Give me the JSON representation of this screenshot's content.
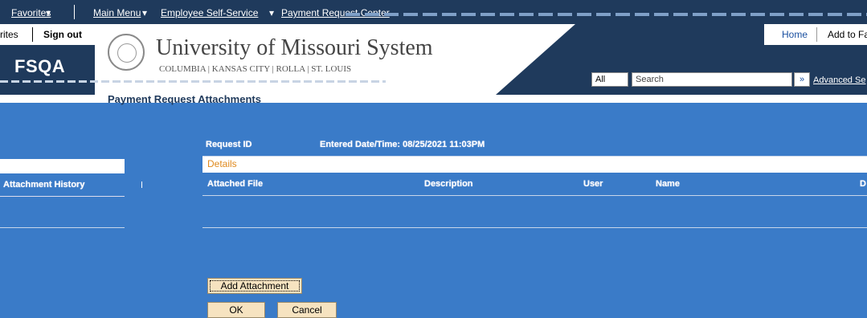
{
  "topnav": {
    "favorites": "Favorites",
    "main_menu": "Main Menu",
    "employee_self_service": "Employee Self-Service",
    "payment_request_center": "Payment Request Center"
  },
  "header": {
    "favorites_partial": "rites",
    "sign_out": "Sign out",
    "home": "Home",
    "add_to_favorites": "Add to Fav",
    "env": "FSQA",
    "university_name": "University of Missouri System",
    "campuses": "COLUMBIA | KANSAS CITY | ROLLA | ST. LOUIS",
    "search_scope": "All",
    "search_placeholder": "Search",
    "advanced_search": "Advanced Se"
  },
  "page": {
    "title": "Payment Request Attachments"
  },
  "request": {
    "request_id_label": "Request ID",
    "entered_label": "Entered Date/Time: 08/25/2021 11:03PM"
  },
  "left_panel": {
    "row_label": "Attachment History"
  },
  "details": {
    "title": "Details",
    "columns": [
      "Attached File",
      "Description",
      "User",
      "Name",
      "D"
    ]
  },
  "buttons": {
    "add_attachment": "Add Attachment",
    "ok": "OK",
    "cancel": "Cancel"
  },
  "colors": {
    "background": "#3a7bc8",
    "header": "#1f3a5c",
    "details_accent": "#e08a1e",
    "button": "#f6e3c0"
  }
}
